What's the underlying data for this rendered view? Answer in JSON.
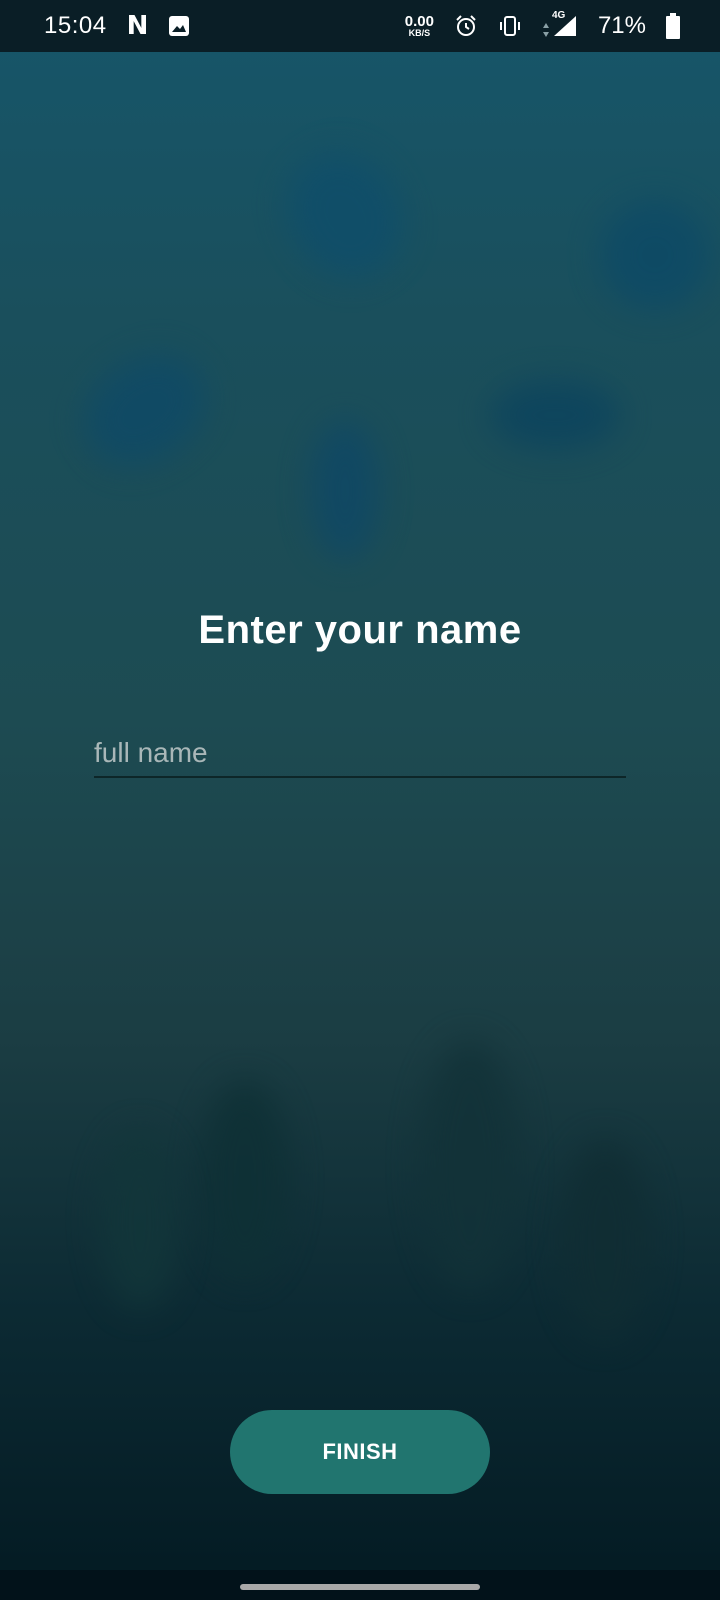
{
  "status_bar": {
    "time": "15:04",
    "net_rate_value": "0.00",
    "net_rate_unit": "KB/S",
    "network_type": "4G",
    "battery_percent": "71%",
    "icons": [
      "netflix-notification-icon",
      "gallery-notification-icon",
      "alarm-icon",
      "vibrate-icon",
      "data-arrows-icon",
      "signal-icon",
      "battery-icon"
    ]
  },
  "main": {
    "title": "Enter your name",
    "name_field": {
      "placeholder": "full name",
      "value": ""
    },
    "finish_label": "FINISH"
  },
  "colors": {
    "accent_button": "#21756f",
    "status_bar_bg": "#0a1e26",
    "text": "#ffffff",
    "placeholder": "#a9b7b8"
  }
}
